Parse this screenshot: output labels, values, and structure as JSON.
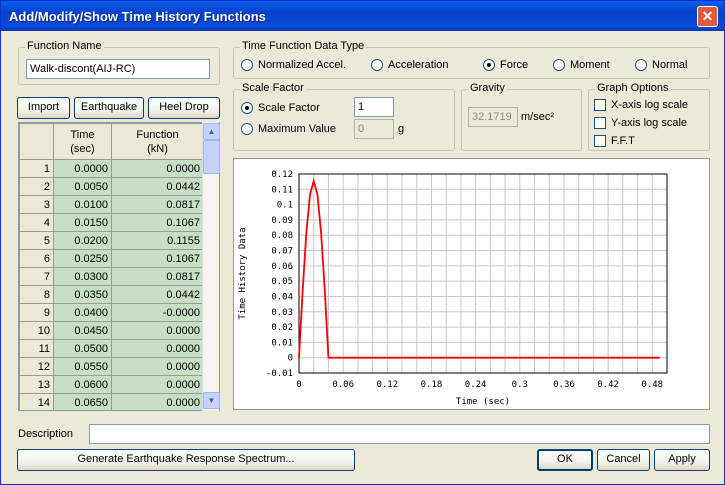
{
  "window": {
    "title": "Add/Modify/Show Time History Functions",
    "close_glyph": "✕"
  },
  "function_name": {
    "label": "Function Name",
    "value": "Walk-discont(AIJ-RC)"
  },
  "buttons": {
    "import": "Import",
    "earthquake": "Earthquake",
    "heel_drop": "Heel Drop",
    "generate": "Generate Earthquake Response Spectrum...",
    "ok": "OK",
    "cancel": "Cancel",
    "apply": "Apply"
  },
  "data_type": {
    "label": "Time Function Data Type",
    "options": [
      "Normalized Accel.",
      "Acceleration",
      "Force",
      "Moment",
      "Normal"
    ],
    "selected": "Force"
  },
  "scale_factor": {
    "label": "Scale Factor",
    "option_scale": "Scale Factor",
    "option_max": "Maximum Value",
    "scale_value": "1",
    "max_value": "0",
    "max_unit": "g"
  },
  "gravity": {
    "label": "Gravity",
    "value": "32.1719",
    "unit": "m/sec²"
  },
  "graph_options": {
    "label": "Graph Options",
    "items": [
      "X-axis log scale",
      "Y-axis log scale",
      "F.F.T"
    ]
  },
  "table": {
    "headers": [
      "Time\n(sec)",
      "Function\n(kN)"
    ],
    "rows": [
      [
        "1",
        "0.0000",
        "0.0000"
      ],
      [
        "2",
        "0.0050",
        "0.0442"
      ],
      [
        "3",
        "0.0100",
        "0.0817"
      ],
      [
        "4",
        "0.0150",
        "0.1067"
      ],
      [
        "5",
        "0.0200",
        "0.1155"
      ],
      [
        "6",
        "0.0250",
        "0.1067"
      ],
      [
        "7",
        "0.0300",
        "0.0817"
      ],
      [
        "8",
        "0.0350",
        "0.0442"
      ],
      [
        "9",
        "0.0400",
        "-0.0000"
      ],
      [
        "10",
        "0.0450",
        "0.0000"
      ],
      [
        "11",
        "0.0500",
        "0.0000"
      ],
      [
        "12",
        "0.0550",
        "0.0000"
      ],
      [
        "13",
        "0.0600",
        "0.0000"
      ],
      [
        "14",
        "0.0650",
        "0.0000"
      ]
    ]
  },
  "description": {
    "label": "Description",
    "value": ""
  },
  "chart_data": {
    "type": "line",
    "xlabel": "Time (sec)",
    "ylabel": "Time History Data",
    "xlim": [
      0,
      0.5
    ],
    "ylim": [
      -0.01,
      0.12
    ],
    "x_ticks": [
      "0",
      "0.06",
      "0.12",
      "0.18",
      "0.24",
      "0.3",
      "0.36",
      "0.42",
      "0.48"
    ],
    "y_ticks": [
      "0.12",
      "0.11",
      "0.1",
      "0.09",
      "0.08",
      "0.07",
      "0.06",
      "0.05",
      "0.04",
      "0.03",
      "0.02",
      "0.01",
      "0",
      "-0.01"
    ],
    "grid": true,
    "series": [
      {
        "color": "#ff0000",
        "x": [
          0,
          0.005,
          0.01,
          0.015,
          0.02,
          0.025,
          0.03,
          0.035,
          0.04,
          0.045,
          0.05,
          0.1,
          0.2,
          0.3,
          0.4,
          0.49
        ],
        "y": [
          0,
          0.0442,
          0.0817,
          0.1067,
          0.1155,
          0.1067,
          0.0817,
          0.0442,
          0,
          0,
          0,
          0,
          0,
          0,
          0,
          0
        ]
      }
    ]
  }
}
